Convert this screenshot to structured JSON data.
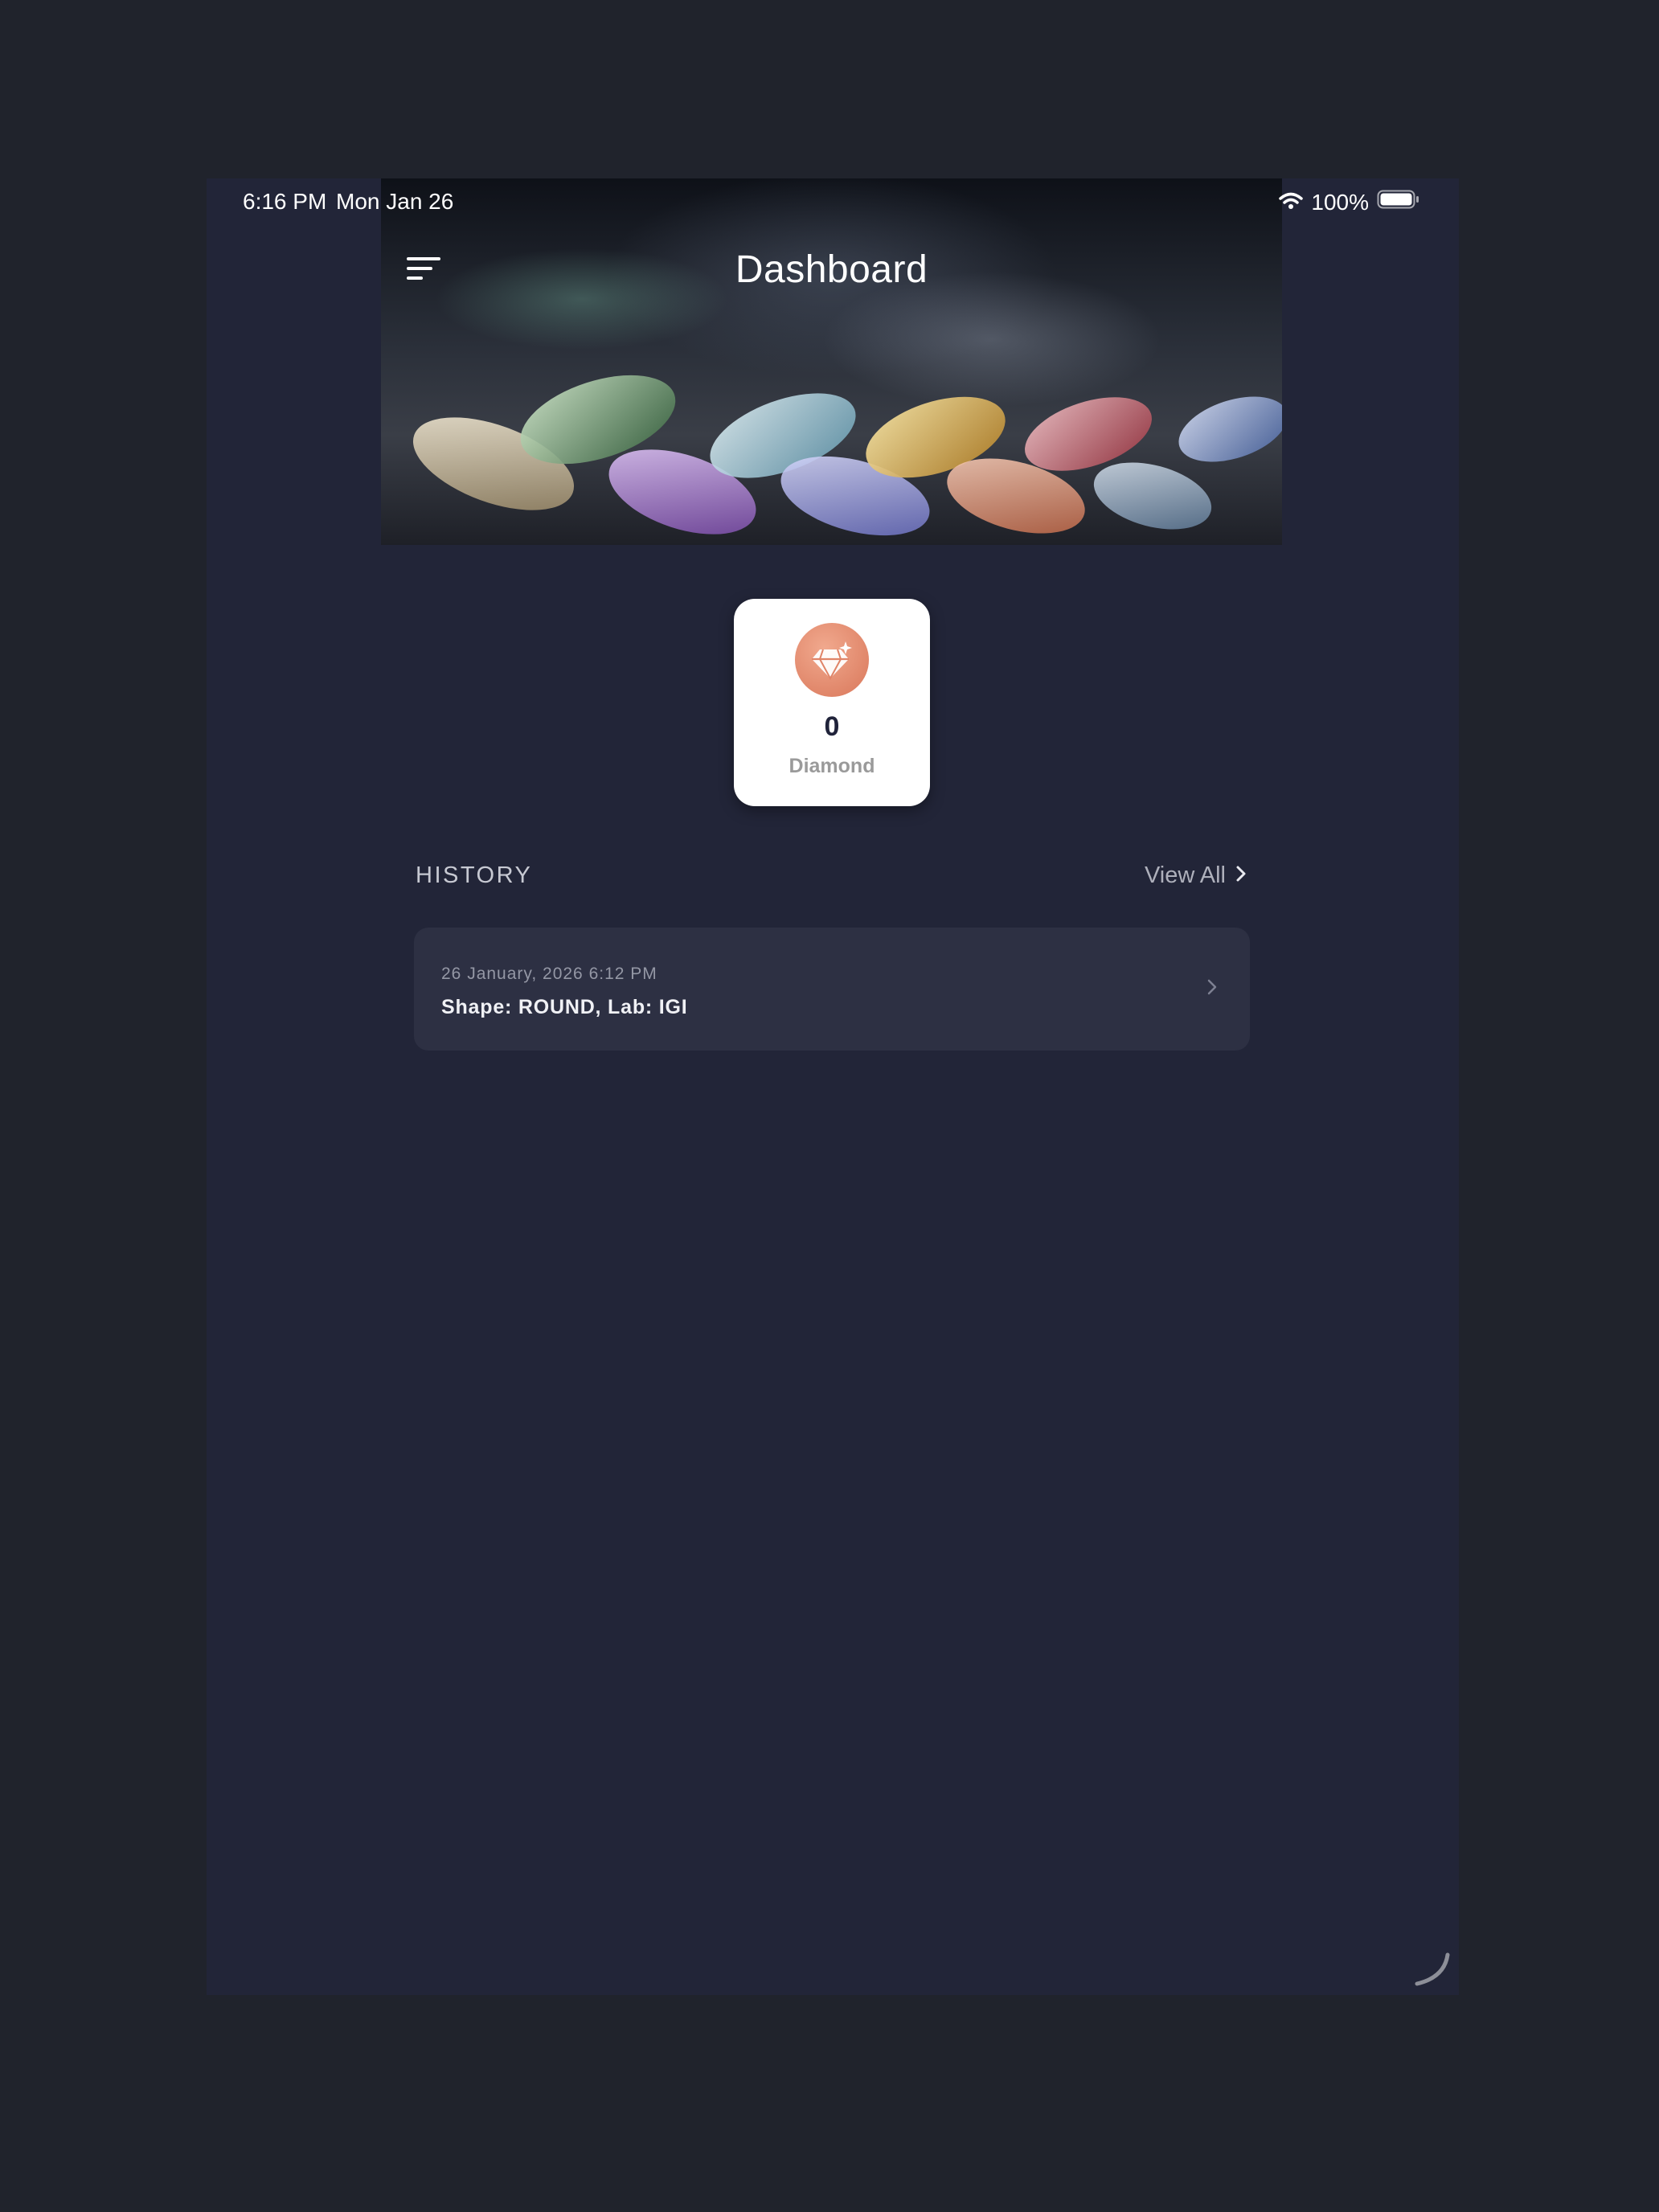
{
  "status_bar": {
    "time": "6:16 PM",
    "date": "Mon Jan 26",
    "battery": "100%",
    "icons": [
      "wifi-icon",
      "battery-icon"
    ]
  },
  "header": {
    "title": "Dashboard",
    "menu_icon": "menu-icon"
  },
  "stats": {
    "icon": "diamond-icon",
    "count": "0",
    "label": "Diamond",
    "icon_color": "#e08468"
  },
  "history": {
    "heading": "HISTORY",
    "view_all_label": "View All",
    "items": [
      {
        "date": "26 January, 2026 6:12 PM",
        "summary": "Shape: ROUND, Lab: IGI"
      }
    ]
  },
  "colors": {
    "background": "#222538",
    "card": "#2d3043",
    "accent": "#e08468"
  }
}
